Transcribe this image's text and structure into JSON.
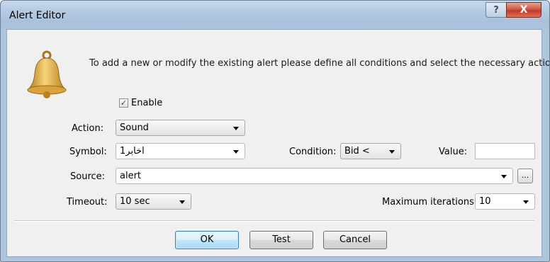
{
  "window": {
    "title": "Alert Editor",
    "help_label": "?",
    "close_label": "X"
  },
  "intro_text": "To add a new or modify the existing alert please define all conditions and select the necessary action.",
  "enable": {
    "label": "Enable",
    "checked": true,
    "check_glyph": "✓"
  },
  "action": {
    "label": "Action:",
    "value": "Sound"
  },
  "symbol": {
    "label": "Symbol:",
    "value": "اخابر1"
  },
  "condition": {
    "label": "Condition:",
    "value": "Bid <"
  },
  "value_field": {
    "label": "Value:",
    "value": ""
  },
  "source": {
    "label": "Source:",
    "value": "alert",
    "browse_label": "..."
  },
  "timeout": {
    "label": "Timeout:",
    "value": "10 sec"
  },
  "max_iterations": {
    "label": "Maximum iterations:",
    "value": "10"
  },
  "buttons": {
    "ok": "OK",
    "test": "Test",
    "cancel": "Cancel"
  },
  "icons": {
    "bell": "bell-icon"
  },
  "colors": {
    "bell_gold": "#e0a93a",
    "title_bar": "#b5cbe3",
    "close_red": "#c13b26"
  }
}
